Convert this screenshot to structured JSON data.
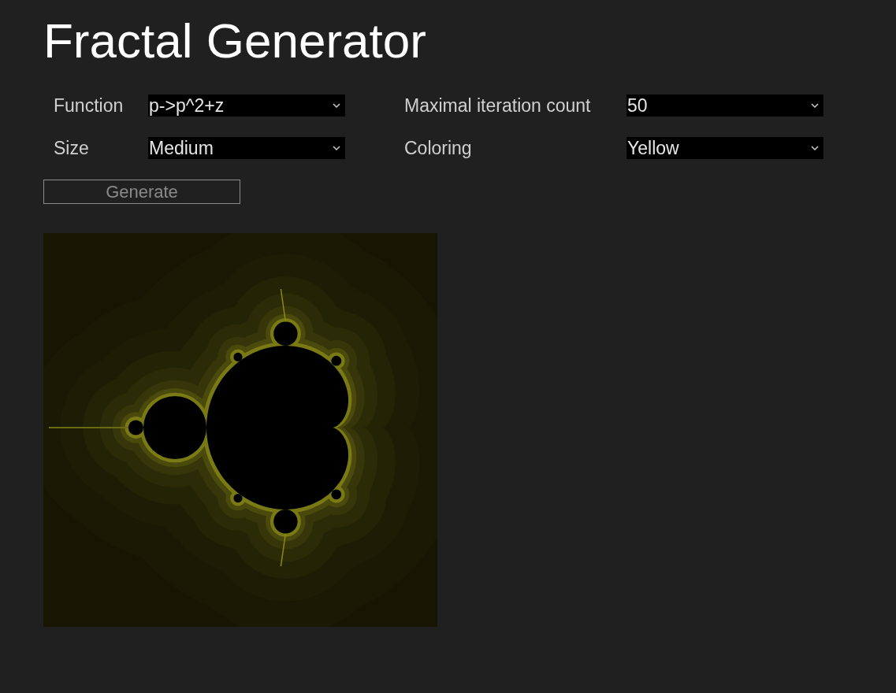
{
  "title": "Fractal Generator",
  "fields": [
    {
      "label": "Function",
      "value": "p->p^2+z"
    },
    {
      "label": "Maximal iteration count",
      "value": "50"
    },
    {
      "label": "Size",
      "value": "Medium"
    },
    {
      "label": "Coloring",
      "value": "Yellow"
    }
  ],
  "button": {
    "label": "Generate",
    "disabled": true
  }
}
